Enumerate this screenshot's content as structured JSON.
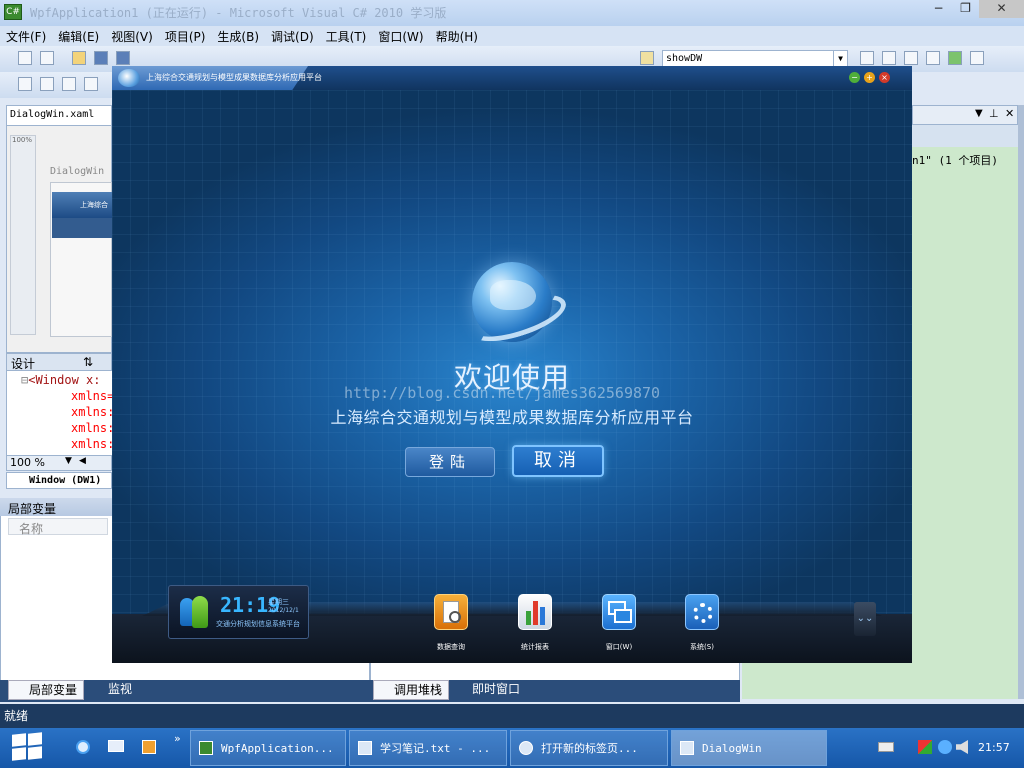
{
  "vs": {
    "logo_text": "C#",
    "title": "WpfApplication1 (正在运行) - Microsoft Visual C# 2010 学习版",
    "window_controls": {
      "minimize": "−",
      "restore": "❐",
      "close": "✕"
    },
    "menu": [
      "文件(F)",
      "编辑(E)",
      "视图(V)",
      "项目(P)",
      "生成(B)",
      "调试(D)",
      "工具(T)",
      "窗口(W)",
      "帮助(H)"
    ],
    "toolbar": {
      "find_combo": "showDW"
    },
    "document_tab": "DialogWin.xaml",
    "designer": {
      "zoom_percent": "100%",
      "window_label": "DialogWin",
      "thumb_title": "上海综合"
    },
    "split_tabs": {
      "design": "设计",
      "swap": "⇅"
    },
    "xml_lines": [
      "<Window x:",
      "xmlns=",
      "xmlns:",
      "xmlns:",
      "xmlns:"
    ],
    "zoom_value": "100 %",
    "breadcrumb": "Window (DW1)",
    "locals": {
      "title": "局部变量",
      "col_name": "名称"
    },
    "bottom_tabs": {
      "locals": "局部变量",
      "watch": "监视",
      "callstack": "调用堆栈",
      "immediate": "即时窗口"
    },
    "right_pane_text": "n1\" (1 个项目)",
    "status": "就绪"
  },
  "dialog": {
    "title": "上海综合交通规划与模型成果数据库分析应用平台",
    "welcome": "欢迎使用",
    "watermark": "http://blog.csdn.net/james362569870",
    "platform_name": "上海综合交通规划与模型成果数据库分析应用平台",
    "login_label": "登陆",
    "cancel_label": "取消",
    "clock_widget": {
      "time": "21:19",
      "weekday": "星期三",
      "date": "2012/12/1",
      "caption": "交通分析规划信息系统平台"
    },
    "dock": [
      {
        "label": "数据查询",
        "color": "#e88a1a"
      },
      {
        "label": "统计报表",
        "color": "#dfe6ef"
      },
      {
        "label": "窗口(W)",
        "color": "#2f8ee8"
      },
      {
        "label": "系统(S)",
        "color": "#2f7fd6"
      }
    ],
    "expand_icon": "⌄⌄"
  },
  "taskbar": {
    "tasks": [
      "WpfApplication...",
      "学习笔记.txt - ...",
      "打开新的标签页...",
      "DialogWin"
    ],
    "time": "21:57",
    "more": "»"
  },
  "colors": {
    "accent": "#1b64a8",
    "taskbar": "#1f63b5"
  }
}
